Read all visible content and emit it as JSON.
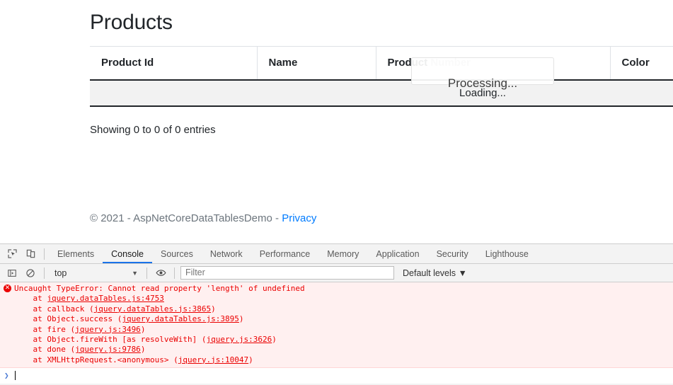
{
  "page": {
    "title": "Products",
    "table": {
      "columns": [
        "Product Id",
        "Name",
        "Product Number",
        "Color"
      ],
      "rows": [],
      "empty_row_placeholder": "",
      "info": "Showing 0 to 0 of 0 entries",
      "processing_label": "Processing...",
      "loading_label": "Loading..."
    },
    "footer": {
      "copyright": "© 2021 - AspNetCoreDataTablesDemo - ",
      "privacy_link": "Privacy"
    }
  },
  "devtools": {
    "icons": {
      "inspect": "inspect-element-icon",
      "device": "device-toolbar-icon",
      "sidebar": "console-sidebar-icon",
      "clear": "clear-console-icon",
      "eye": "live-expression-icon"
    },
    "tabs": [
      {
        "label": "Elements",
        "active": false
      },
      {
        "label": "Console",
        "active": true
      },
      {
        "label": "Sources",
        "active": false
      },
      {
        "label": "Network",
        "active": false
      },
      {
        "label": "Performance",
        "active": false
      },
      {
        "label": "Memory",
        "active": false
      },
      {
        "label": "Application",
        "active": false
      },
      {
        "label": "Security",
        "active": false
      },
      {
        "label": "Lighthouse",
        "active": false
      }
    ],
    "console_toolbar": {
      "context": "top",
      "context_caret": "▼",
      "filter_placeholder": "Filter",
      "filter_value": "",
      "levels": "Default levels ▼"
    },
    "console_output": {
      "error_badge": "✕",
      "lines": [
        {
          "indent": 0,
          "text": "Uncaught TypeError: Cannot read property 'length' of undefined",
          "link": null
        },
        {
          "indent": 1,
          "text": "    at ",
          "link": "jquery.dataTables.js:4753",
          "suffix": ""
        },
        {
          "indent": 1,
          "text": "    at callback (",
          "link": "jquery.dataTables.js:3865",
          "suffix": ")"
        },
        {
          "indent": 1,
          "text": "    at Object.success (",
          "link": "jquery.dataTables.js:3895",
          "suffix": ")"
        },
        {
          "indent": 1,
          "text": "    at fire (",
          "link": "jquery.js:3496",
          "suffix": ")"
        },
        {
          "indent": 1,
          "text": "    at Object.fireWith [as resolveWith] (",
          "link": "jquery.js:3626",
          "suffix": ")"
        },
        {
          "indent": 1,
          "text": "    at done (",
          "link": "jquery.js:9786",
          "suffix": ")"
        },
        {
          "indent": 1,
          "text": "    at XMLHttpRequest.<anonymous> (",
          "link": "jquery.js:10047",
          "suffix": ")"
        }
      ],
      "prompt_arrow": "❯",
      "prompt_value": ""
    }
  },
  "colors": {
    "accent": "#1a73e8",
    "link": "#007bff",
    "error": "#eb0000",
    "error_bg": "#fff0f0",
    "header_border": "#212529",
    "row_bg": "#f2f2f2",
    "devtools_bg": "#f3f3f3"
  }
}
